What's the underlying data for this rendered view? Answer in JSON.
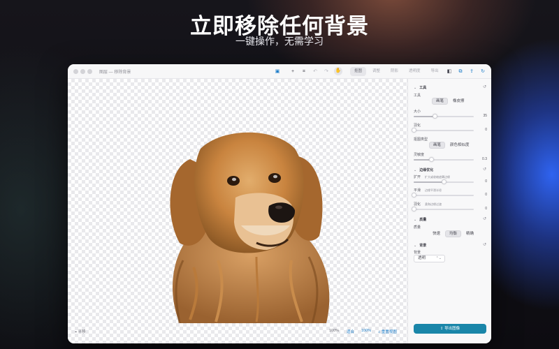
{
  "hero": {
    "title": "立即移除任何背景",
    "subtitle": "一键操作，无需学习"
  },
  "window": {
    "title": "图层 — 移除背景",
    "toolbar": {
      "icons": [
        "sidebar-toggle-icon",
        "add-icon",
        "crop-icon",
        "undo-icon",
        "redo-icon",
        "hand-icon"
      ],
      "tabs": [
        {
          "label": "抠图",
          "active": true
        },
        {
          "label": "调整",
          "active": false
        },
        {
          "label": "阴影",
          "active": false
        },
        {
          "label": "透明度",
          "active": false
        },
        {
          "label": "导出",
          "active": false
        }
      ],
      "right_icons": [
        "compare-icon",
        "copy-icon",
        "share-icon",
        "refresh-icon"
      ]
    }
  },
  "canvas": {
    "footer_left": "平移",
    "zoom_a": "100%",
    "fit": "适合",
    "zoom_b": "100%",
    "reset_view": "重置视图"
  },
  "panel": {
    "tools": {
      "header": "工具",
      "label": "工具",
      "options": [
        "画笔",
        "橡皮擦"
      ],
      "selected": "画笔",
      "size_label": "大小",
      "size_value": "35",
      "size_fraction": 0.35,
      "feather_label": "羽化",
      "feather_value": "0",
      "feather_fraction": 0.0,
      "selection_label": "抠图类型",
      "selection_options": [
        "画笔",
        "颜色相似度"
      ],
      "selection_selected": "画笔",
      "tolerance_label": "灵敏度",
      "tolerance_value": "0.3",
      "tolerance_fraction": 0.3
    },
    "edge": {
      "header": "边缘优化",
      "expand_label": "扩开",
      "expand_hint": "扩大或收缩遮罩边缘",
      "expand_value": "0",
      "expand_fraction": 0.5,
      "smooth_label": "平滑",
      "smooth_hint": "边缘平滑半径",
      "smooth_value": "0",
      "smooth_fraction": 0.0,
      "feather_label": "羽化",
      "feather_hint": "柔和边缘过渡",
      "feather_value": "0",
      "feather_fraction": 0.0
    },
    "quality": {
      "header": "质量",
      "label": "质量",
      "options": [
        "快速",
        "均衡",
        "精确"
      ],
      "selected": "均衡"
    },
    "background": {
      "header": "背景",
      "label": "背景",
      "value": "透明"
    },
    "export_label": "导出图像"
  },
  "colors": {
    "accent": "#1a86a9",
    "link": "#1b7cc8",
    "window_bg": "#ffffff",
    "panel_bg": "#f8f8f9"
  }
}
